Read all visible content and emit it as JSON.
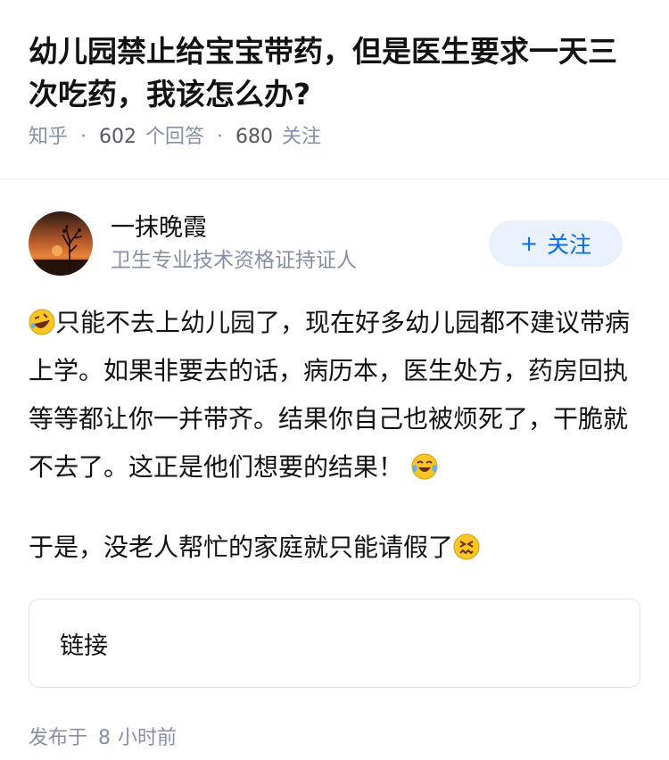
{
  "question": {
    "title": "幼儿园禁止给宝宝带药，但是医生要求一天三次吃药，我该怎么办?",
    "source": "知乎",
    "answer_count": "602",
    "answer_label": "个回答",
    "follower_count": "680",
    "follower_label": "关注",
    "separator": "·"
  },
  "author": {
    "name": "一抹晚霞",
    "badge": "卫生专业技术资格证持证人",
    "follow_plus": "+",
    "follow_label": "关注"
  },
  "answer": {
    "para1": "只能不去上幼儿园了，现在好多幼儿园都不建议带病上学。如果非要去的话，病历本，医生处方，药房回执等等都让你一并带齐。结果你自己也被烦死了，干脆就不去了。这正是他们想要的结果！",
    "para2": "于是，没老人帮忙的家庭就只能请假了"
  },
  "link_card": {
    "label": "链接"
  },
  "footer": {
    "prefix": "发布于",
    "time_value": "8",
    "time_unit": "小时前"
  },
  "colors": {
    "accent": "#056de8",
    "meta": "#8590a6",
    "follow_bg": "#e8f1fc"
  }
}
